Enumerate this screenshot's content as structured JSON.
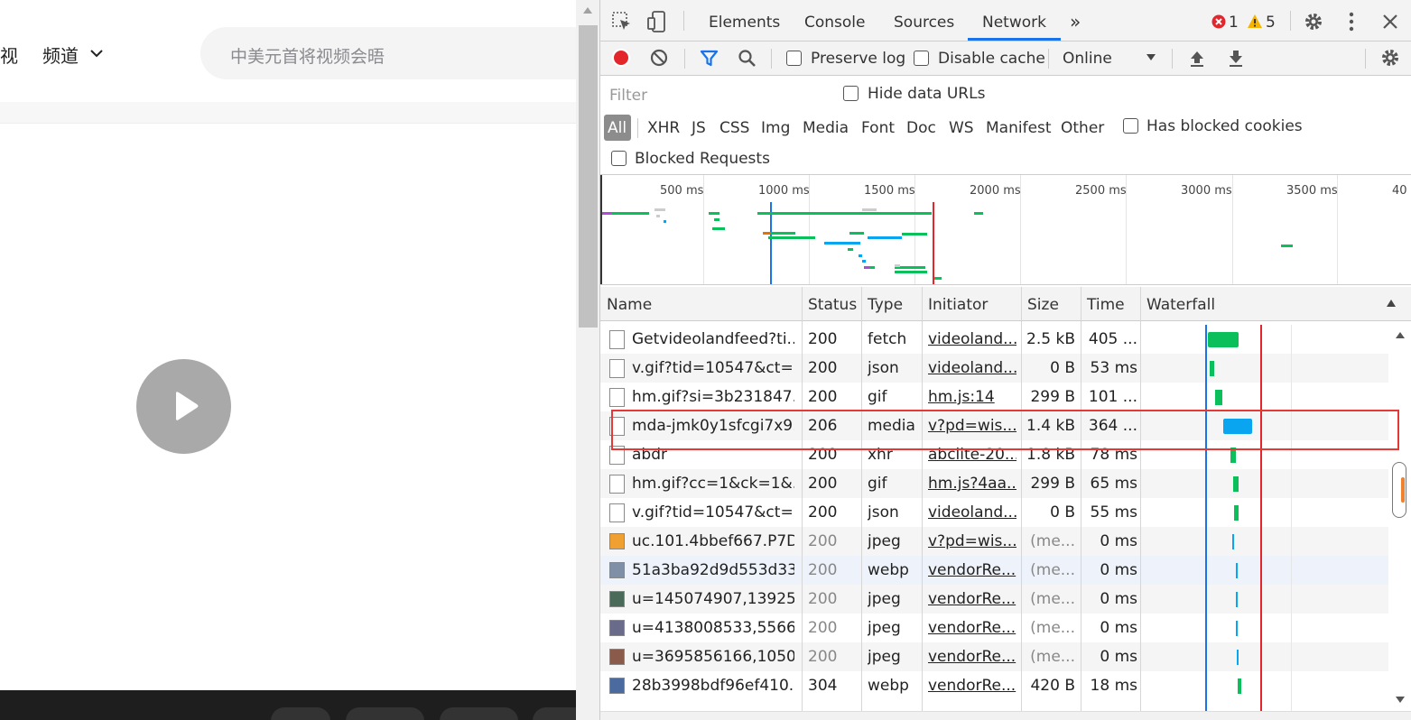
{
  "left_page": {
    "nav_partial": "视",
    "channel_label": "频道",
    "search_placeholder": "中美元首将视频会晤"
  },
  "devtools": {
    "tabs": [
      "Elements",
      "Console",
      "Sources",
      "Network"
    ],
    "active_tab": "Network",
    "more_tabs": "»",
    "errors": "1",
    "warnings": "5",
    "toolbar": {
      "preserve_log": "Preserve log",
      "disable_cache": "Disable cache",
      "throttling": "Online"
    },
    "filter": {
      "placeholder": "Filter",
      "hide_data_urls": "Hide data URLs",
      "types": [
        "All",
        "XHR",
        "JS",
        "CSS",
        "Img",
        "Media",
        "Font",
        "Doc",
        "WS",
        "Manifest",
        "Other"
      ],
      "has_blocked_cookies": "Has blocked cookies",
      "blocked_requests": "Blocked Requests"
    },
    "overview_ticks": [
      "500 ms",
      "1000 ms",
      "1500 ms",
      "2000 ms",
      "2500 ms",
      "3000 ms",
      "3500 ms",
      "40"
    ],
    "columns": [
      "Name",
      "Status",
      "Type",
      "Initiator",
      "Size",
      "Time",
      "Waterfall"
    ],
    "rows": [
      {
        "name": "Getvideolandfeed?ti...",
        "status": "200",
        "type": "fetch",
        "initiator": "videoland....",
        "size": "2.5 kB",
        "time": "405 ..."
      },
      {
        "name": "v.gif?tid=10547&ct=...",
        "status": "200",
        "type": "json",
        "initiator": "videoland....",
        "size": "0 B",
        "time": "53 ms"
      },
      {
        "name": "hm.gif?si=3b231847...",
        "status": "200",
        "type": "gif",
        "initiator": "hm.js:14",
        "size": "299 B",
        "time": "101 ..."
      },
      {
        "name": "mda-jmk0y1sfcgi7x9...",
        "status": "206",
        "type": "media",
        "initiator": "v?pd=wis...",
        "size": "1.4 kB",
        "time": "364 ..."
      },
      {
        "name": "abdr",
        "status": "200",
        "type": "xhr",
        "initiator": "abclite-20...",
        "size": "1.8 kB",
        "time": "78 ms"
      },
      {
        "name": "hm.gif?cc=1&ck=1&...",
        "status": "200",
        "type": "gif",
        "initiator": "hm.js?4aa...",
        "size": "299 B",
        "time": "65 ms"
      },
      {
        "name": "v.gif?tid=10547&ct=...",
        "status": "200",
        "type": "json",
        "initiator": "videoland....",
        "size": "0 B",
        "time": "55 ms"
      },
      {
        "name": "uc.101.4bbef667.P7D...",
        "status": "200",
        "type": "jpeg",
        "initiator": "v?pd=wis...",
        "size": "(me...",
        "time": "0 ms"
      },
      {
        "name": "51a3ba92d9d553d33...",
        "status": "200",
        "type": "webp",
        "initiator": "vendorRe...",
        "size": "(me...",
        "time": "0 ms"
      },
      {
        "name": "u=145074907,13925...",
        "status": "200",
        "type": "jpeg",
        "initiator": "vendorRe...",
        "size": "(me...",
        "time": "0 ms"
      },
      {
        "name": "u=4138008533,5566...",
        "status": "200",
        "type": "jpeg",
        "initiator": "vendorRe...",
        "size": "(me...",
        "time": "0 ms"
      },
      {
        "name": "u=3695856166,1050...",
        "status": "200",
        "type": "jpeg",
        "initiator": "vendorRe...",
        "size": "(me...",
        "time": "0 ms"
      },
      {
        "name": "28b3998bdf96ef410...",
        "status": "304",
        "type": "webp",
        "initiator": "vendorRe...",
        "size": "420 B",
        "time": "18 ms"
      }
    ]
  },
  "colors": {
    "record_red": "#e3262b",
    "accent_blue": "#1a73e8",
    "waterfall_green": "#0bbf5a",
    "waterfall_blue": "#0aa5f0",
    "highlight_box": "#e53935"
  }
}
